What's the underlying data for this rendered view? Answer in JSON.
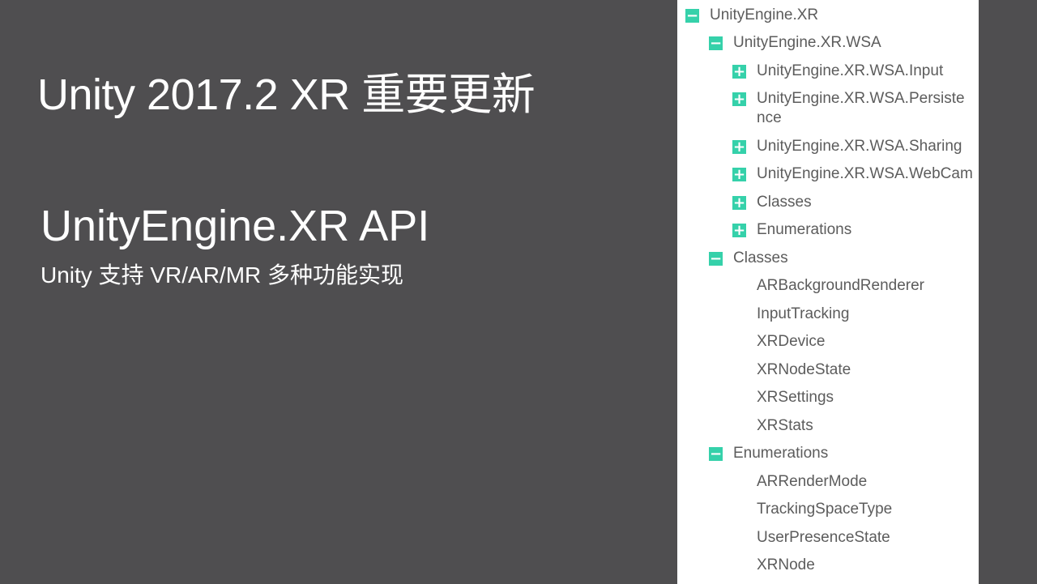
{
  "slide": {
    "title": "Unity 2017.2 XR 重要更新",
    "api_title": "UnityEngine.XR API",
    "api_subtitle": "Unity 支持 VR/AR/MR 多种功能实现"
  },
  "tree": {
    "toggle_colors": {
      "accent": "#35d1aa",
      "text": "#5c5c5c",
      "background": "#ffffff",
      "slide_bg": "#4f4e50"
    },
    "items": [
      {
        "label": "UnityEngine.XR",
        "toggle": "−",
        "icon": "collapse-icon"
      },
      {
        "label": "UnityEngine.XR.WSA",
        "toggle": "−",
        "icon": "collapse-icon"
      },
      {
        "label": "UnityEngine.XR.WSA.Input",
        "toggle": "+",
        "icon": "expand-icon"
      },
      {
        "label": "UnityEngine.XR.WSA.Persistence",
        "toggle": "+",
        "icon": "expand-icon"
      },
      {
        "label": "UnityEngine.XR.WSA.Sharing",
        "toggle": "+",
        "icon": "expand-icon"
      },
      {
        "label": "UnityEngine.XR.WSA.WebCam",
        "toggle": "+",
        "icon": "expand-icon"
      },
      {
        "label": "Classes",
        "toggle": "+",
        "icon": "expand-icon"
      },
      {
        "label": "Enumerations",
        "toggle": "+",
        "icon": "expand-icon"
      },
      {
        "label": "Classes",
        "toggle": "−",
        "icon": "collapse-icon"
      },
      {
        "label": "ARBackgroundRenderer"
      },
      {
        "label": "InputTracking"
      },
      {
        "label": "XRDevice"
      },
      {
        "label": "XRNodeState"
      },
      {
        "label": "XRSettings"
      },
      {
        "label": "XRStats"
      },
      {
        "label": "Enumerations",
        "toggle": "−",
        "icon": "collapse-icon"
      },
      {
        "label": "ARRenderMode"
      },
      {
        "label": "TrackingSpaceType"
      },
      {
        "label": "UserPresenceState"
      },
      {
        "label": "XRNode"
      }
    ]
  }
}
